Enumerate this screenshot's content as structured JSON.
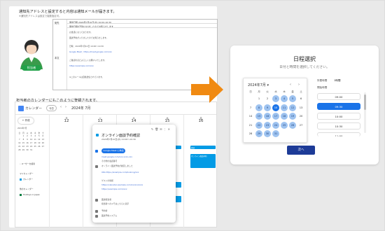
{
  "left_panel": {
    "instruction": "通知先アドレスと設定すると内容は通知メールが届きます。",
    "note": "※通知先アドレスは設定で複数指定可。",
    "rep_label": "担当者",
    "mail": {
      "label_to": "宛先",
      "label_body": "本文",
      "rows": [
        "面談日時 2024年7月10日(水) 10:00-10:30",
        "面談日時が予約されましたのでお知らせします"
      ],
      "body_lines": [
        "お世話になっております。",
        "面談予約が入りましたのでお知らせします。",
        "",
        "日時：2024年7月10日 10:00〜10:30",
        "Google Meet：https://meet.google.com/xxx",
        "",
        "ご確認のほどよろしくお願いいたします。",
        "https://example.com/xxx",
        "",
        "※このメールは自動送信されています。"
      ]
    },
    "calendar_instruction": "担当者のカレンダーにもこのように登録されます。"
  },
  "calendar": {
    "app_name": "カレンダー",
    "today_label": "今日",
    "month_label": "2024年 7月",
    "create_label": "+ 作成",
    "mini_month": "2024年7月",
    "mini_weekdays": [
      "日",
      "月",
      "火",
      "水",
      "木",
      "金",
      "土"
    ],
    "mini_rows": [
      [
        "",
        "1",
        "2",
        "3",
        "4",
        "5",
        "6"
      ],
      [
        "7",
        "8",
        "9",
        "10",
        "11",
        "12",
        "13"
      ],
      [
        "14",
        "15",
        "16",
        "17",
        "18",
        "19",
        "20"
      ],
      [
        "21",
        "22",
        "23",
        "24",
        "25",
        "26",
        "27"
      ],
      [
        "28",
        "29",
        "30",
        "31",
        "",
        "",
        ""
      ]
    ],
    "side_items": [
      "ユーザーを検索",
      "マイカレンダー",
      "カレンダー",
      "他のカレンダー",
      "Holidays in Japan"
    ],
    "days": [
      {
        "dow": "月",
        "num": "12"
      },
      {
        "dow": "火",
        "num": "13"
      },
      {
        "dow": "水",
        "num": "14"
      },
      {
        "dow": "木",
        "num": "15"
      },
      {
        "dow": "金",
        "num": "16"
      }
    ],
    "events": [
      "オンライン面談予約",
      "打ち合わせ",
      "面談",
      "オンライン面談予約",
      "定例"
    ]
  },
  "popup": {
    "title": "オンライン面談予約確認",
    "subtitle": "2024年7月10日(水) 10:00〜10:30",
    "meet_button": "Google Meet に参加",
    "lines": [
      "meet.google.com/xxx-xxxx-xxx",
      "その他の電話番号",
      "オンライン面談予約が確定しました",
      "URL:https://example.com/booking/xxx",
      "https://calendar.example.com/xxxxxxxxxx",
      "ゲストの情報",
      "https://example.com/xxxx",
      "面談担当者",
      "担当者へのメモはこちらに表示",
      "予約者",
      "面談予約システム"
    ]
  },
  "booking": {
    "title": "日程選択",
    "subtitle": "日付と時間を選択してください。",
    "month": "2024年7月",
    "weekdays": [
      "日",
      "月",
      "火",
      "水",
      "木",
      "金",
      "土"
    ],
    "weeks": [
      [
        "",
        "1",
        "2",
        "3",
        "4",
        "5",
        "6"
      ],
      [
        "7",
        "8",
        "9",
        "10",
        "11",
        "12",
        "13"
      ],
      [
        "14",
        "15",
        "16",
        "17",
        "18",
        "19",
        "20"
      ],
      [
        "21",
        "22",
        "23",
        "24",
        "25",
        "26",
        "27"
      ],
      [
        "28",
        "29",
        "30",
        "31",
        "",
        "",
        ""
      ]
    ],
    "available": [
      "3",
      "4",
      "5",
      "8",
      "9",
      "10",
      "11",
      "12",
      "15",
      "16",
      "17",
      "18",
      "19",
      "22",
      "23",
      "24",
      "25",
      "26",
      "29",
      "30",
      "31"
    ],
    "selected": "10",
    "duration_label": "所要時間",
    "duration_value": "1時間",
    "timezone_label": "開始時間",
    "slots": [
      "09:00",
      "09:30",
      "10:00",
      "10:30",
      "11:00"
    ],
    "selected_slot": "09:30",
    "next_label": "次へ"
  },
  "colors": {
    "accent": "#1a73e8",
    "button": "#1d3b97",
    "arrow": "#f08a12",
    "rep": "#22a24a"
  }
}
